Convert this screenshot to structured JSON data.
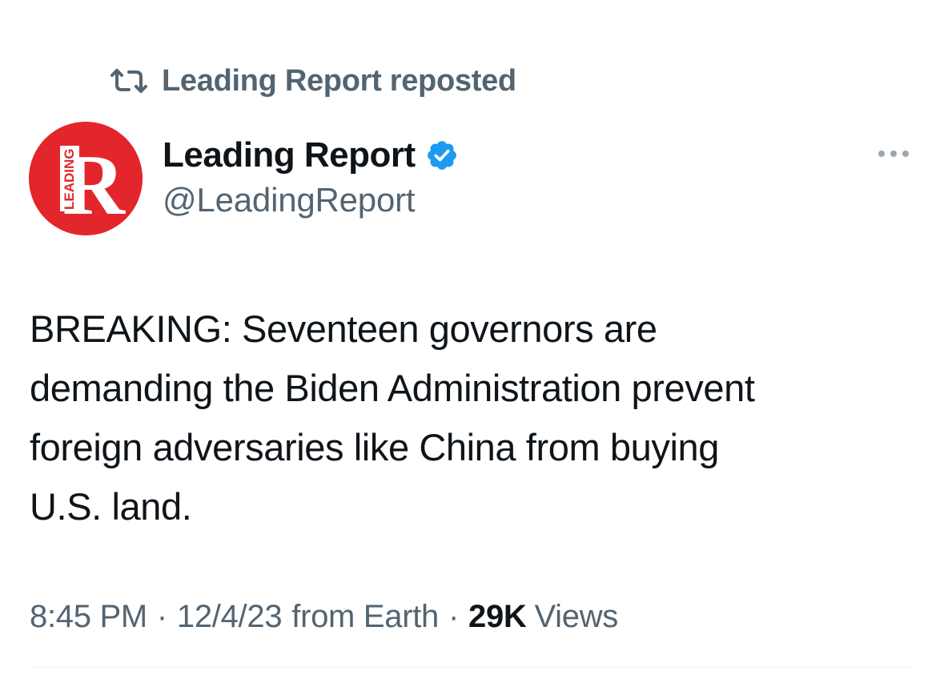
{
  "repost": {
    "icon": "repost-icon",
    "text": "Leading Report reposted"
  },
  "author": {
    "avatar_icon": "leading-report-logo",
    "avatar_letter": "R",
    "avatar_small_text": "LEADING",
    "name": "Leading Report",
    "handle": "@LeadingReport",
    "verified": true,
    "verified_color": "#1d9bf0"
  },
  "more_icon": "more-options-icon",
  "tweet": {
    "lines": [
      "BREAKING: Seventeen governors are",
      "demanding the Biden Administration prevent",
      "foreign adversaries like China from buying",
      "U.S. land."
    ]
  },
  "meta": {
    "time": "8:45 PM",
    "separator": "·",
    "date": "12/4/23",
    "source": "from Earth",
    "views_count": "29K",
    "views_label": "Views"
  },
  "colors": {
    "text_primary": "#0f1419",
    "text_secondary": "#536471",
    "brand_red": "#e3262b",
    "divider": "#eff3f4"
  }
}
